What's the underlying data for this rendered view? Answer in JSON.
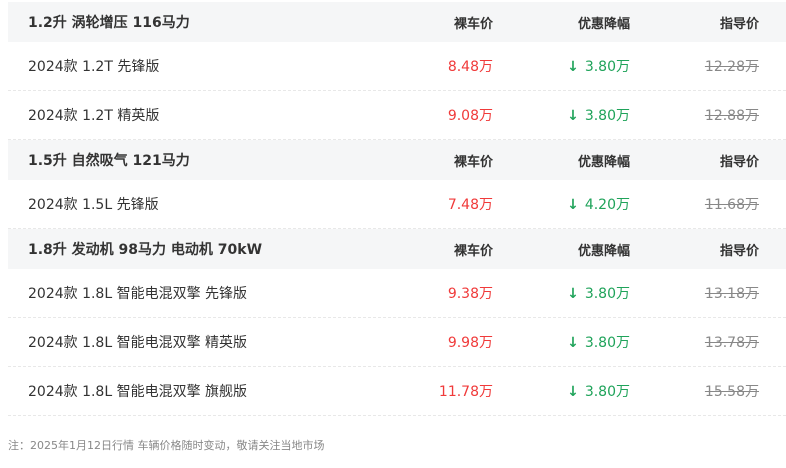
{
  "headers": {
    "price": "裸车价",
    "discount": "优惠降幅",
    "guide": "指导价"
  },
  "groups": [
    {
      "title": "1.2升 涡轮增压 116马力",
      "rows": [
        {
          "name": "2024款 1.2T 先锋版",
          "price": "8.48万",
          "discount": "3.80万",
          "guide": "12.28万"
        },
        {
          "name": "2024款 1.2T 精英版",
          "price": "9.08万",
          "discount": "3.80万",
          "guide": "12.88万"
        }
      ]
    },
    {
      "title": "1.5升 自然吸气 121马力",
      "rows": [
        {
          "name": "2024款 1.5L 先锋版",
          "price": "7.48万",
          "discount": "4.20万",
          "guide": "11.68万"
        }
      ]
    },
    {
      "title": "1.8升 发动机 98马力 电动机 70kW",
      "rows": [
        {
          "name": "2024款 1.8L 智能电混双擎 先锋版",
          "price": "9.38万",
          "discount": "3.80万",
          "guide": "13.18万"
        },
        {
          "name": "2024款 1.8L 智能电混双擎 精英版",
          "price": "9.98万",
          "discount": "3.80万",
          "guide": "13.78万"
        },
        {
          "name": "2024款 1.8L 智能电混双擎 旗舰版",
          "price": "11.78万",
          "discount": "3.80万",
          "guide": "15.58万"
        }
      ]
    }
  ],
  "note": "注：2025年1月12日行情 车辆价格随时变动，敬请关注当地市场",
  "colors": {
    "price": "#f03a3a",
    "discount": "#1fa35a",
    "header_bg": "#f5f6f7"
  },
  "icons": {
    "discount_arrow": "down-arrow-icon"
  }
}
